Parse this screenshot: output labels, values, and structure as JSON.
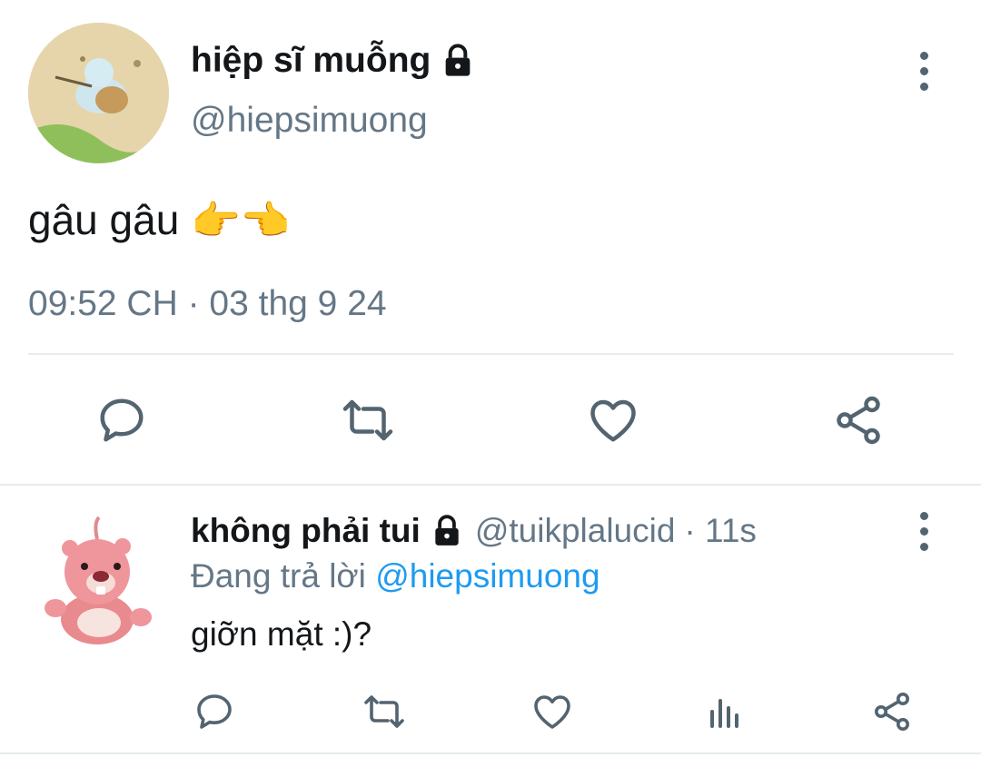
{
  "main_tweet": {
    "display_name": "hiệp sĩ muỗng",
    "handle": "@hiepsimuong",
    "text": "gâu gâu",
    "emoji": "👉👈",
    "timestamp": "09:52 CH · 03 thg 9 24",
    "actions": [
      "reply-icon",
      "retweet-icon",
      "like-icon",
      "share-icon"
    ]
  },
  "reply_tweet": {
    "display_name": "không phải tui",
    "handle": "@tuikplalucid",
    "time_ago": "· 11s",
    "replying_prefix": "Đang trả lời",
    "replying_to": "@hiepsimuong",
    "text": "giỡn mặt :)?",
    "actions": [
      "reply-icon",
      "retweet-icon",
      "like-icon",
      "analytics-icon",
      "share-icon"
    ]
  },
  "colors": {
    "accent": "#1d9bf0",
    "icon_gray": "#536471",
    "divider": "#e6ecf0"
  }
}
